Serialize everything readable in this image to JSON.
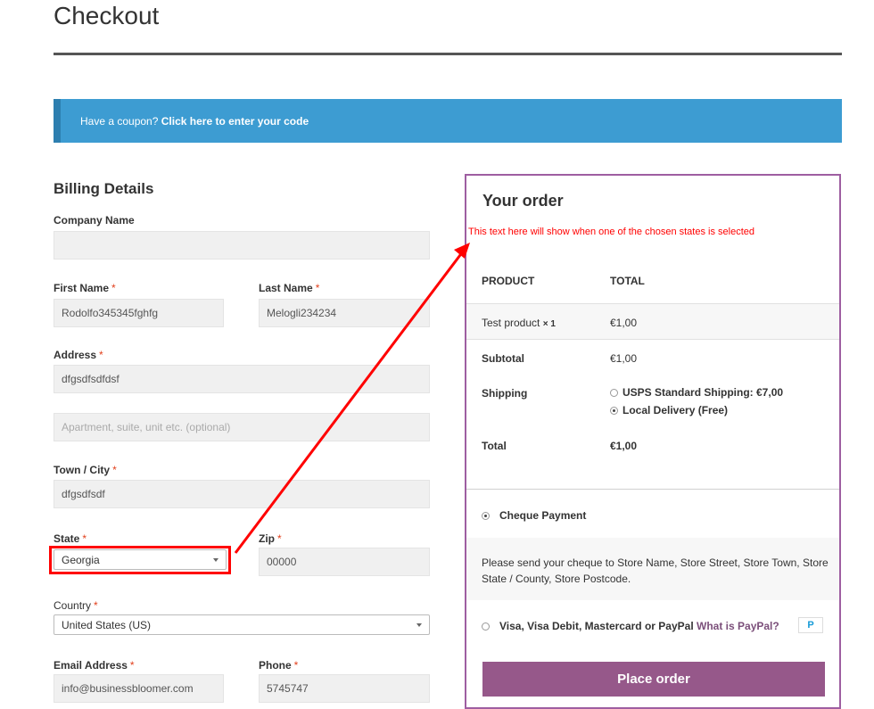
{
  "page": {
    "title": "Checkout"
  },
  "coupon": {
    "prefix": "Have a coupon?",
    "link": "Click here to enter your code"
  },
  "billing": {
    "heading": "Billing Details",
    "required_mark": "*",
    "company": {
      "label": "Company Name",
      "value": ""
    },
    "first_name": {
      "label": "First Name",
      "value": "Rodolfo345345fghfg"
    },
    "last_name": {
      "label": "Last Name",
      "value": "Melogli234234"
    },
    "address": {
      "label": "Address",
      "value": "dfgsdfsdfdsf"
    },
    "address2": {
      "placeholder": "Apartment, suite, unit etc. (optional)"
    },
    "city": {
      "label": "Town / City",
      "value": "dfgsdfsdf"
    },
    "state": {
      "label": "State",
      "value": "Georgia"
    },
    "zip": {
      "label": "Zip",
      "value": "00000"
    },
    "country": {
      "label": "Country",
      "value": "United States (US)"
    },
    "email": {
      "label": "Email Address",
      "value": "info@businessbloomer.com"
    },
    "phone": {
      "label": "Phone",
      "value": "5745747"
    }
  },
  "order": {
    "heading": "Your order",
    "state_note": "This text here will show when one of the chosen states is selected",
    "col_product": "PRODUCT",
    "col_total": "TOTAL",
    "item": {
      "name": "Test product",
      "qty": "× 1",
      "total": "€1,00"
    },
    "subtotal": {
      "label": "Subtotal",
      "value": "€1,00"
    },
    "shipping": {
      "label": "Shipping",
      "options": [
        {
          "label": "USPS Standard Shipping: €7,00",
          "selected": false
        },
        {
          "label": "Local Delivery (Free)",
          "selected": true
        }
      ]
    },
    "total": {
      "label": "Total",
      "value": "€1,00"
    }
  },
  "payment": {
    "cheque": {
      "label": "Cheque Payment",
      "selected": true,
      "description": "Please send your cheque to Store Name, Store Street, Store Town, Store State / County, Store Postcode."
    },
    "paypal": {
      "label": "Visa, Visa Debit, Mastercard or PayPal",
      "link": "What is PayPal?",
      "selected": false,
      "badge": "P"
    },
    "place_order": "Place order"
  },
  "colors": {
    "accent": "#96588a",
    "coupon_bg": "#3d9cd2",
    "annotation": "#ff0000"
  },
  "annotation": {
    "arrow": "from state select to state note"
  }
}
